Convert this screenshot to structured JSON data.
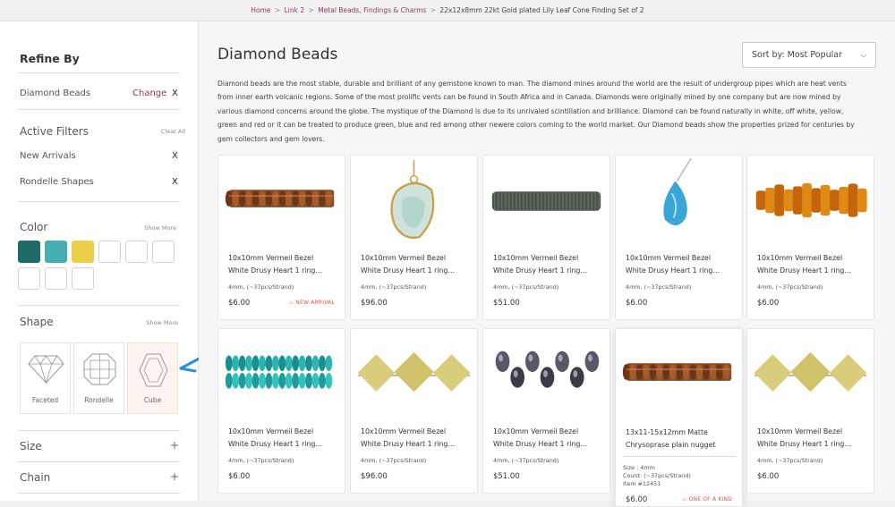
{
  "breadcrumb": {
    "items": [
      "Home",
      "Link 2",
      "Metal Beads, Findings & Charms"
    ],
    "current": "22x12x8mm 22kt Gold plated Lily Leaf Cone Finding Set of 2",
    "separator": ">"
  },
  "sidebar": {
    "title": "Refine By",
    "category": {
      "label": "Diamond Beads",
      "change": "Change",
      "remove": "X"
    },
    "active_filters": {
      "title": "Active Filters",
      "clear_all": "Clear All",
      "items": [
        {
          "label": "New Arrivals",
          "remove": "X"
        },
        {
          "label": "Rondelle Shapes",
          "remove": "X"
        }
      ]
    },
    "color": {
      "title": "Color",
      "show_more": "Show More",
      "swatches": [
        "#1f6b67",
        "#46aeb0",
        "#ecd04c",
        "#ffffff",
        "#ffffff",
        "#ffffff",
        "#ffffff",
        "#ffffff",
        "#ffffff"
      ]
    },
    "shape": {
      "title": "Shape",
      "show_more": "Show More",
      "options": [
        {
          "label": "Faceted",
          "icon": "diamond-icon",
          "selected": false
        },
        {
          "label": "Rondelle",
          "icon": "rondelle-icon",
          "selected": false
        },
        {
          "label": "Cube",
          "icon": "cube-icon",
          "selected": true
        }
      ]
    },
    "accordions": [
      {
        "label": "Size",
        "icon": "+"
      },
      {
        "label": "Chain",
        "icon": "+"
      }
    ]
  },
  "main": {
    "title": "Diamond Beads",
    "sort": {
      "label": "Sort by: Most Popular",
      "icon": "chevron-down-icon"
    },
    "description": "Diamond beads are the most stable, durable and brilliant of any gemstone known to man. The diamond mines around the world are the result of undergroup pipes which are heat vents from inner earth volcanic regions. Some of the most prolific vents can be found in South Africa and in Canada. Diamonds were originally mined by one company but are now mined by various diamond concerns around the globe. The mystique of the Diamond is due to its unrivaled scintillation and brilliance. Diamond can be found naturally in white, off white, yellow, green and red or it can be treated to produce green, blue and red among other newere colors coming to the world market. Our Diamond beads show the properties prized for centuries by gem collectors and gem lovers.",
    "products": [
      {
        "line1": "10x10mm Vermeil Bezel",
        "line2": "White Drusy Heart 1 ring…",
        "meta": "4mm, (~37pcs/Strand)",
        "price": "$6.00",
        "badge": "NEW ARRIVAL",
        "image": "bronze-rondelle-strand"
      },
      {
        "line1": "10x10mm Vermeil Bezel",
        "line2": "White Drusy Heart 1 ring…",
        "meta": "4mm, (~37pcs/Strand)",
        "price": "$96.00",
        "badge": "",
        "image": "aqua-drusy-pendant"
      },
      {
        "line1": "10x10mm Vermeil Bezel",
        "line2": "White Drusy Heart 1 ring…",
        "meta": "4mm, (~37pcs/Strand)",
        "price": "$51.00",
        "badge": "",
        "image": "gray-heishi-strand"
      },
      {
        "line1": "10x10mm Vermeil Bezel",
        "line2": "White Drusy Heart 1 ring…",
        "meta": "4mm, (~37pcs/Strand)",
        "price": "$6.00",
        "badge": "",
        "image": "blue-topaz-drop"
      },
      {
        "line1": "10x10mm Vermeil Bezel",
        "line2": "White Drusy Heart 1 ring…",
        "meta": "4mm, (~37pcs/Strand)",
        "price": "$6.00",
        "badge": "",
        "image": "amber-nugget-strand"
      },
      {
        "line1": "10x10mm Vermeil Bezel",
        "line2": "White Drusy Heart 1 ring…",
        "meta": "4mm, (~37pcs/Strand)",
        "price": "$6.00",
        "badge": "",
        "image": "teal-rondelle-strand"
      },
      {
        "line1": "10x10mm Vermeil Bezel",
        "line2": "White Drusy Heart 1 ring…",
        "meta": "4mm, (~37pcs/Strand)",
        "price": "$96.00",
        "badge": "",
        "image": "lemon-cube-strand"
      },
      {
        "line1": "10x10mm Vermeil Bezel",
        "line2": "White Drusy Heart 1 ring…",
        "meta": "4mm, (~37pcs/Strand)",
        "price": "$51.00",
        "badge": "",
        "image": "mystic-drop-strand"
      },
      {
        "line1": "13x11-15x12mm Matte",
        "line2": "Chrysoprase plain nugget",
        "size": "Size : 4mm",
        "count": "Count: (~37pcs/Strand)",
        "item": "Item #12451",
        "price": "$6.00",
        "badge": "ONE OF A KIND",
        "image": "bronze-rondelle-strand",
        "hovered": true
      },
      {
        "line1": "10x10mm Vermeil Bezel",
        "line2": "White Drusy Heart 1 ring…",
        "meta": "4mm, (~37pcs/Strand)",
        "price": "$6.00",
        "badge": "",
        "image": "lemon-cube-strand"
      }
    ]
  }
}
